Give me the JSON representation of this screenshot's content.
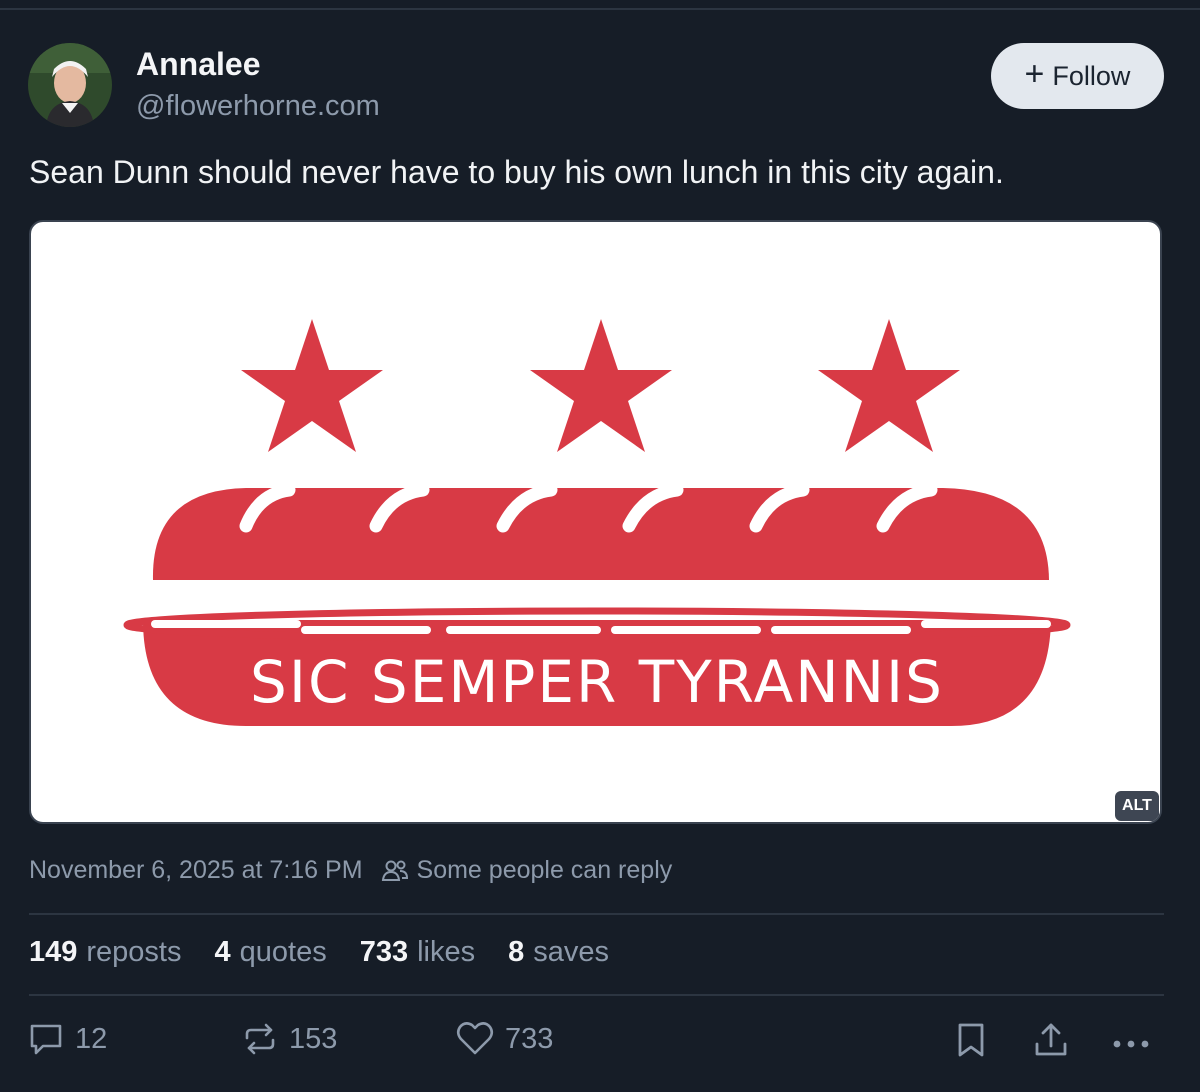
{
  "author": {
    "name": "Annalee",
    "handle": "@flowerhorne.com"
  },
  "follow_button": {
    "label": "Follow"
  },
  "post": {
    "text": "Sean Dunn should never have to buy his own lunch in this city again.",
    "image": {
      "caption": "SIC SEMPER TYRANNIS",
      "alt_badge": "ALT",
      "colors": {
        "red": "#d83a45",
        "background": "#ffffff"
      }
    },
    "timestamp": "November 6, 2025 at 7:16 PM",
    "reply_setting": "Some people can reply"
  },
  "stats": {
    "reposts": {
      "count": "149",
      "label": "reposts"
    },
    "quotes": {
      "count": "4",
      "label": "quotes"
    },
    "likes": {
      "count": "733",
      "label": "likes"
    },
    "saves": {
      "count": "8",
      "label": "saves"
    }
  },
  "actions": {
    "reply_count": "12",
    "repost_count": "153",
    "like_count": "733"
  },
  "icons": [
    "people-icon",
    "reply-icon",
    "repost-icon",
    "heart-icon",
    "bookmark-icon",
    "share-icon",
    "more-icon"
  ],
  "theme": {
    "background": "#161d27",
    "muted_text": "#8d9aab",
    "divider": "#2c3541"
  }
}
